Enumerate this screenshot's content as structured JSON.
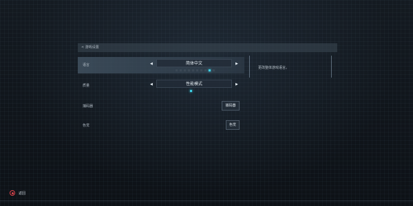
{
  "header": {
    "title": "< 游戏设置"
  },
  "rows": [
    {
      "label": "语言",
      "value": "简体中文",
      "selected": true,
      "dots_total": 10,
      "dot_active": 9
    },
    {
      "label": "质量",
      "value": "性能模式",
      "selected": false,
      "dots_total": 1,
      "dot_active": 1
    },
    {
      "label": "捕码器",
      "button": "捕码器"
    },
    {
      "label": "色觉",
      "button": "色觉"
    }
  ],
  "description": {
    "text": "更改整体游戏语言。"
  },
  "footer": {
    "back_label": "返回"
  },
  "colors": {
    "accent": "#3fd0e6",
    "back_icon": "#e0444c"
  }
}
